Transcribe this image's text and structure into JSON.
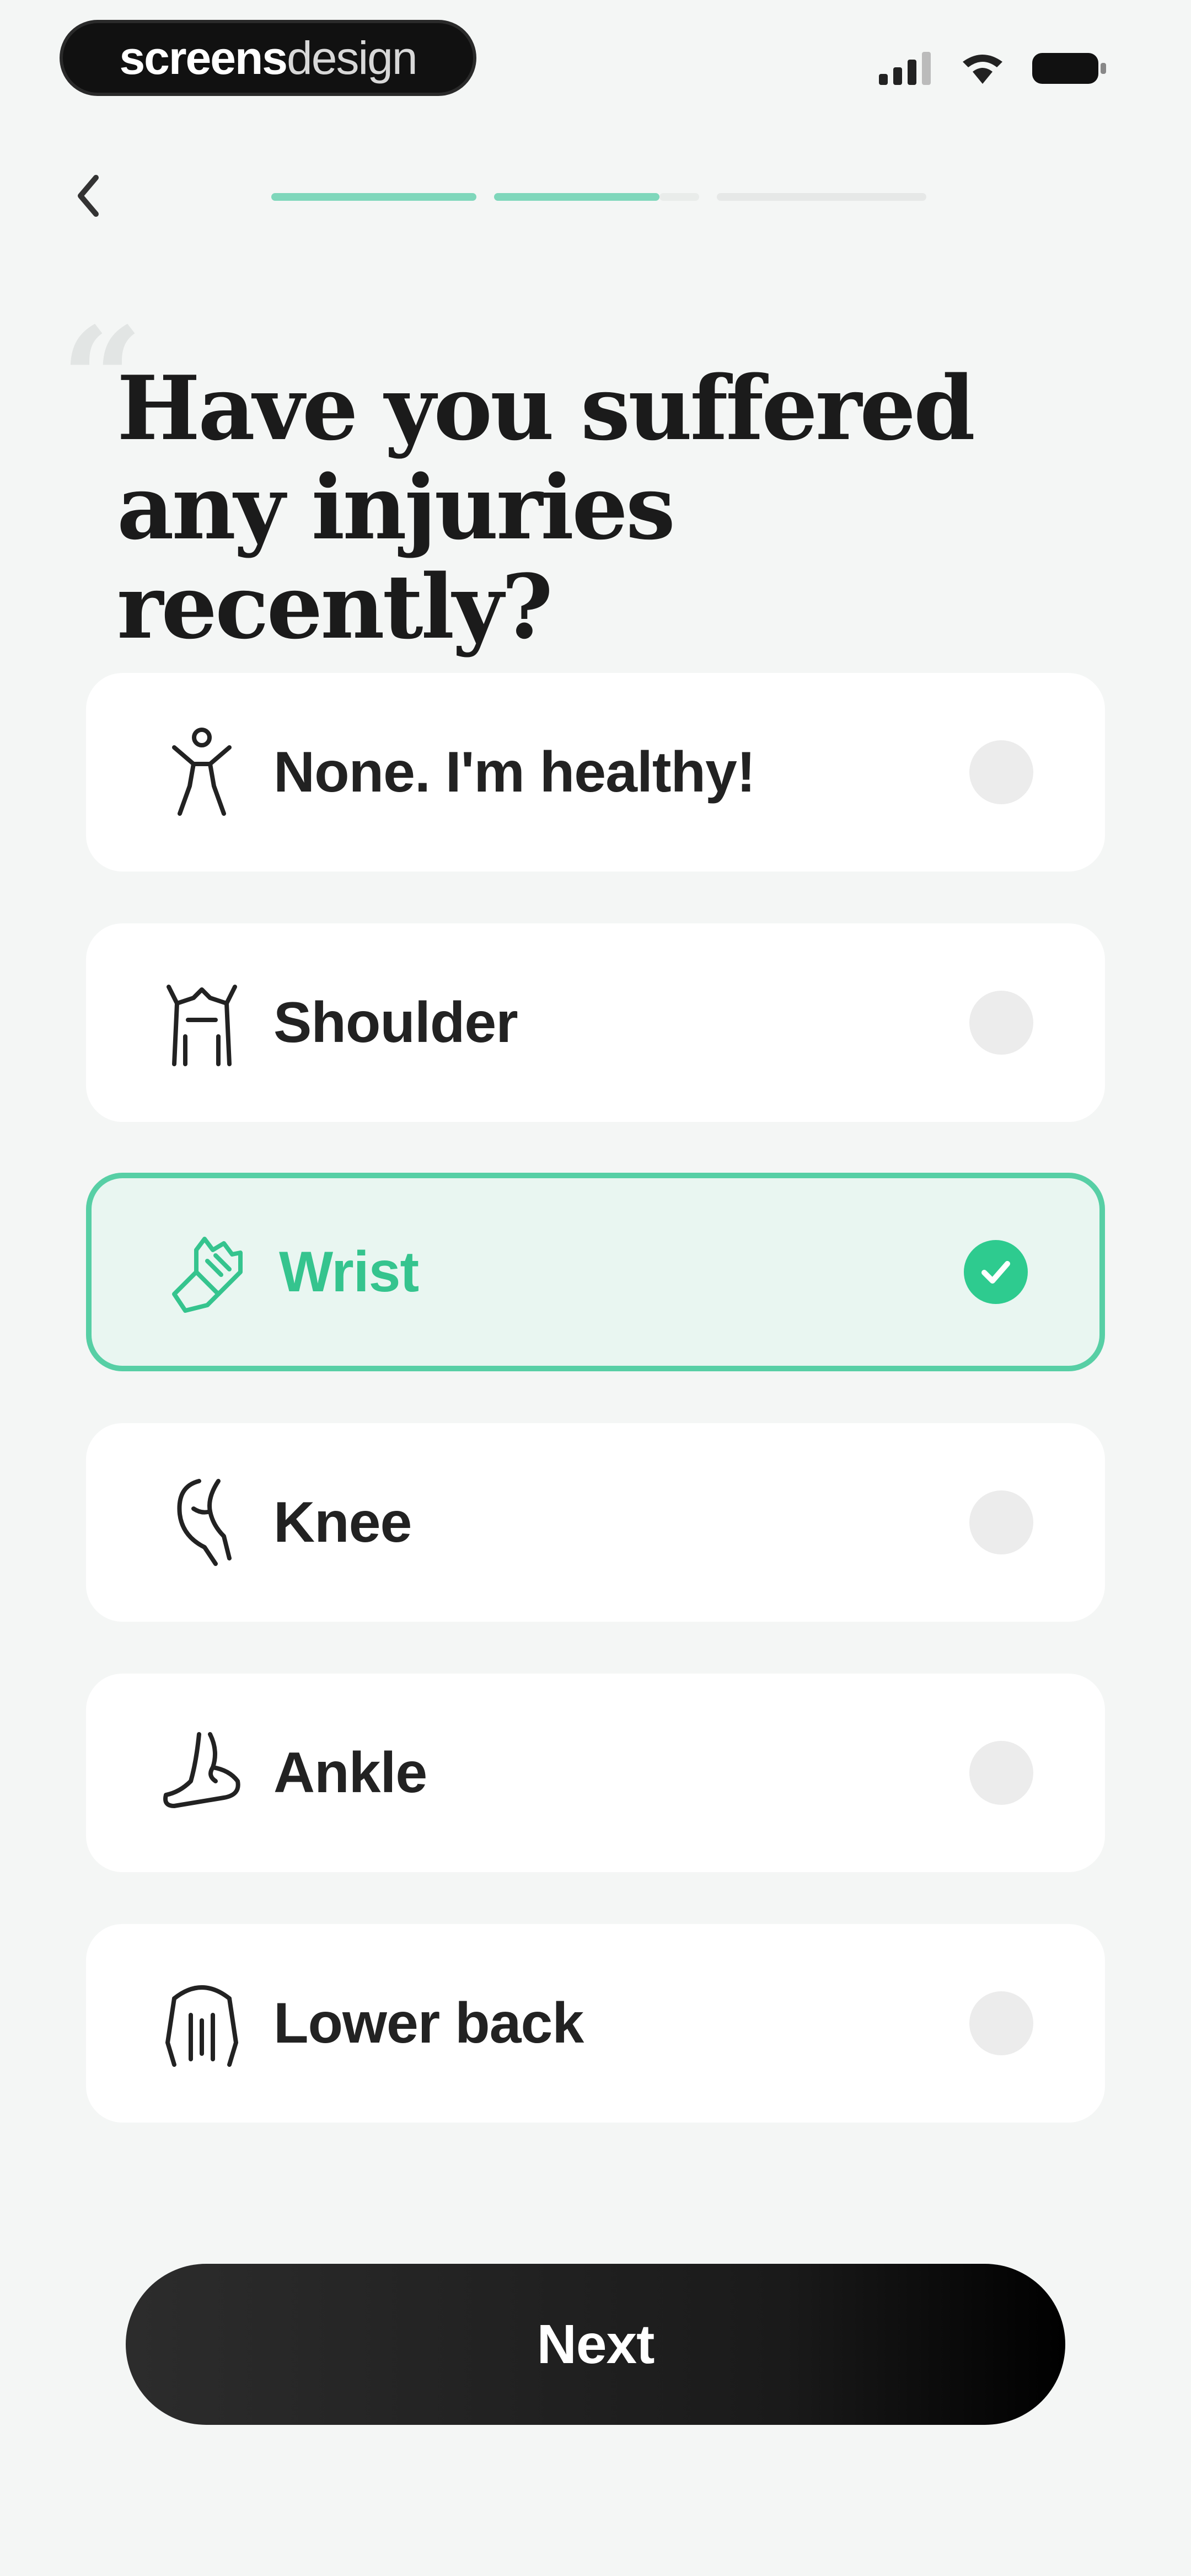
{
  "status_bar": {
    "brand_left": "screens",
    "brand_right": "design"
  },
  "progress": {
    "steps_total": 3,
    "steps_completed": 2
  },
  "question": {
    "title": "Have you suffered any injuries recently?"
  },
  "options": [
    {
      "label": "None. I'm healthy!",
      "icon": "person-standing-icon",
      "selected": false
    },
    {
      "label": "Shoulder",
      "icon": "shoulder-icon",
      "selected": false
    },
    {
      "label": "Wrist",
      "icon": "wrist-icon",
      "selected": true
    },
    {
      "label": "Knee",
      "icon": "knee-icon",
      "selected": false
    },
    {
      "label": "Ankle",
      "icon": "ankle-icon",
      "selected": false
    },
    {
      "label": "Lower back",
      "icon": "lower-back-icon",
      "selected": false
    }
  ],
  "actions": {
    "next_label": "Next"
  },
  "colors": {
    "accent": "#2ecb8f",
    "selected_bg": "#e9f6f1",
    "progress_inactive": "#e6e8e7",
    "button_bg": "#1a1a1a"
  }
}
